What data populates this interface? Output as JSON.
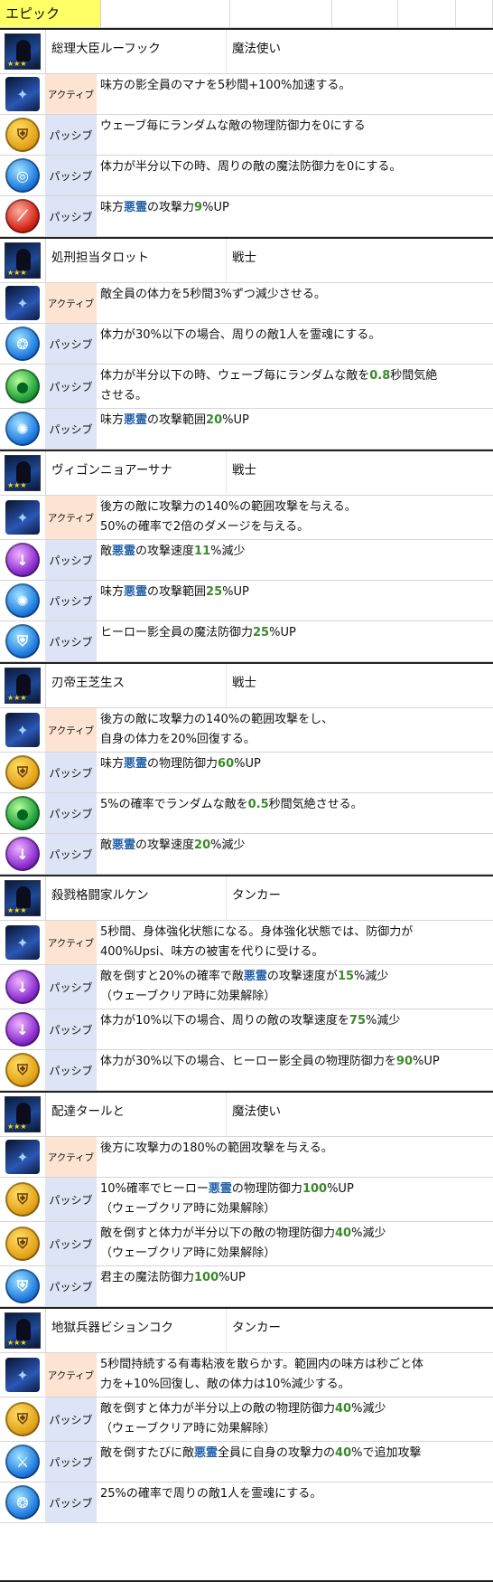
{
  "header": {
    "title": "エピック"
  },
  "labels": {
    "active": "アクティブ",
    "passive": "パッシブ"
  },
  "colors": {
    "header_bg": "#ffff66",
    "active_bg": "#fde3d2",
    "passive_bg": "#dce4f5",
    "highlight": "#3a8a2a",
    "keyword": "#1f5fa8"
  },
  "heroes": [
    {
      "name": "総理大臣ルーフック",
      "role": "魔法使い",
      "skills": [
        {
          "type": "active",
          "icon": "dark-hero-skill-icon",
          "lines": [
            [
              {
                "t": "味方の影全員のマナを5秒間+100%加速する。"
              }
            ]
          ]
        },
        {
          "type": "passive",
          "icon": "gold-shield-icon",
          "lines": [
            [
              {
                "t": "ウェーブ毎にランダムな敵の物理防御力を0にする"
              }
            ]
          ]
        },
        {
          "type": "passive",
          "icon": "blue-swirl-icon",
          "lines": [
            [
              {
                "t": "体力が半分以下の時、周りの敵の魔法防御力を0にする。"
              }
            ]
          ]
        },
        {
          "type": "passive",
          "icon": "red-claw-icon",
          "lines": [
            [
              {
                "t": "味方"
              },
              {
                "t": "悪霊",
                "s": "bl"
              },
              {
                "t": "の攻撃力"
              },
              {
                "t": "9",
                "s": "hl"
              },
              {
                "t": "%UP"
              }
            ]
          ]
        }
      ]
    },
    {
      "name": "処刑担当タロット",
      "role": "戦士",
      "skills": [
        {
          "type": "active",
          "icon": "dark-hero-skill-icon",
          "lines": [
            [
              {
                "t": "敵全員の体力を5秒間3%ずつ減少させる。"
              }
            ]
          ]
        },
        {
          "type": "passive",
          "icon": "blue-spirit-icon",
          "lines": [
            [
              {
                "t": "体力が30%以下の場合、周りの敵1人を霊魂にする。"
              }
            ]
          ]
        },
        {
          "type": "passive",
          "icon": "green-person-icon",
          "lines": [
            [
              {
                "t": "体力が半分以下の時、ウェーブ毎にランダムな敵を"
              },
              {
                "t": "0.8",
                "s": "hl"
              },
              {
                "t": "秒間気絶"
              }
            ],
            [
              {
                "t": "させる。"
              }
            ]
          ]
        },
        {
          "type": "passive",
          "icon": "blue-burst-icon",
          "lines": [
            [
              {
                "t": "味方"
              },
              {
                "t": "悪霊",
                "s": "bl"
              },
              {
                "t": "の攻撃範囲"
              },
              {
                "t": "20",
                "s": "hl"
              },
              {
                "t": "%UP"
              }
            ]
          ]
        }
      ]
    },
    {
      "name": "ヴィゴンニョアーサナ",
      "role": "戦士",
      "skills": [
        {
          "type": "active",
          "icon": "dark-hero-skill-icon",
          "lines": [
            [
              {
                "t": "後方の敵に攻撃力の140%の範囲攻撃を与える。"
              }
            ],
            [
              {
                "t": "50%の確率で2倍のダメージを与える。"
              }
            ]
          ]
        },
        {
          "type": "passive",
          "icon": "purple-down-arrow-icon",
          "lines": [
            [
              {
                "t": "敵"
              },
              {
                "t": "悪霊",
                "s": "bl"
              },
              {
                "t": "の攻撃速度"
              },
              {
                "t": "11",
                "s": "hl"
              },
              {
                "t": "%減少"
              }
            ]
          ]
        },
        {
          "type": "passive",
          "icon": "blue-burst-icon",
          "lines": [
            [
              {
                "t": "味方"
              },
              {
                "t": "悪霊",
                "s": "bl"
              },
              {
                "t": "の攻撃範囲"
              },
              {
                "t": "25",
                "s": "hl"
              },
              {
                "t": "%UP"
              }
            ]
          ]
        },
        {
          "type": "passive",
          "icon": "blue-shield-icon",
          "lines": [
            [
              {
                "t": "ヒーロー影全員の魔法防御力"
              },
              {
                "t": "25",
                "s": "hl"
              },
              {
                "t": "%UP"
              }
            ]
          ]
        }
      ]
    },
    {
      "name": "刃帝王芝生ス",
      "role": "戦士",
      "skills": [
        {
          "type": "active",
          "icon": "dark-hero-skill-icon",
          "lines": [
            [
              {
                "t": "後方の敵に攻撃力の140%の範囲攻撃をし、"
              }
            ],
            [
              {
                "t": "自身の体力を20%回復する。"
              }
            ]
          ]
        },
        {
          "type": "passive",
          "icon": "gold-shield-icon",
          "lines": [
            [
              {
                "t": "味方"
              },
              {
                "t": "悪霊",
                "s": "bl"
              },
              {
                "t": "の物理防御力"
              },
              {
                "t": "60",
                "s": "hl"
              },
              {
                "t": "%UP"
              }
            ]
          ]
        },
        {
          "type": "passive",
          "icon": "green-person-icon",
          "lines": [
            [
              {
                "t": "5%の確率でランダムな敵を"
              },
              {
                "t": "0.5",
                "s": "hl"
              },
              {
                "t": "秒間気絶させる。"
              }
            ]
          ]
        },
        {
          "type": "passive",
          "icon": "purple-down-arrow-icon",
          "lines": [
            [
              {
                "t": "敵"
              },
              {
                "t": "悪霊",
                "s": "bl"
              },
              {
                "t": "の攻撃速度"
              },
              {
                "t": "20",
                "s": "hl"
              },
              {
                "t": "%減少"
              }
            ]
          ]
        }
      ]
    },
    {
      "name": "殺戮格闘家ルケン",
      "role": "タンカー",
      "skills": [
        {
          "type": "active",
          "icon": "dark-hero-skill-icon",
          "lines": [
            [
              {
                "t": "5秒間、身体強化状態になる。身体強化状態では、防御力が"
              }
            ],
            [
              {
                "t": "400%Upsi、味方の被害を代りに受ける。"
              }
            ]
          ]
        },
        {
          "type": "passive",
          "icon": "purple-down-arrow-icon",
          "lines": [
            [
              {
                "t": "敵を倒すと20%の確率で敵"
              },
              {
                "t": "悪霊",
                "s": "bl"
              },
              {
                "t": "の攻撃速度が"
              },
              {
                "t": "15",
                "s": "hl"
              },
              {
                "t": "%減少"
              }
            ],
            [
              {
                "t": "（ウェーブクリア時に効果解除）"
              }
            ]
          ]
        },
        {
          "type": "passive",
          "icon": "purple-down-arrow-icon",
          "lines": [
            [
              {
                "t": "体力が10%以下の場合、周りの敵の攻撃速度を"
              },
              {
                "t": "75",
                "s": "hl"
              },
              {
                "t": "%減少"
              }
            ]
          ]
        },
        {
          "type": "passive",
          "icon": "gold-shield-icon",
          "lines": [
            [
              {
                "t": "体力が30%以下の場合、ヒーロー影全員の物理防御力を"
              },
              {
                "t": "90",
                "s": "hl"
              },
              {
                "t": "%UP"
              }
            ]
          ]
        }
      ]
    },
    {
      "name": "配達タールと",
      "role": "魔法使い",
      "skills": [
        {
          "type": "active",
          "icon": "dark-hero-skill-icon",
          "lines": [
            [
              {
                "t": "後方に攻撃力の180%の範囲攻撃を与える。"
              }
            ]
          ]
        },
        {
          "type": "passive",
          "icon": "gold-shield-icon",
          "lines": [
            [
              {
                "t": "10%確率でヒーロー"
              },
              {
                "t": "悪霊",
                "s": "bl"
              },
              {
                "t": "の物理防御力"
              },
              {
                "t": "100",
                "s": "hl"
              },
              {
                "t": "%UP"
              }
            ],
            [
              {
                "t": "（ウェーブクリア時に効果解除）"
              }
            ]
          ]
        },
        {
          "type": "passive",
          "icon": "gold-broken-shield-icon",
          "lines": [
            [
              {
                "t": "敵を倒すと体力が半分以下の敵の物理防御力"
              },
              {
                "t": "40",
                "s": "hl"
              },
              {
                "t": "%減少"
              }
            ],
            [
              {
                "t": "（ウェーブクリア時に効果解除）"
              }
            ]
          ]
        },
        {
          "type": "passive",
          "icon": "blue-shield-icon",
          "lines": [
            [
              {
                "t": "君主の魔法防御力"
              },
              {
                "t": "100",
                "s": "hl"
              },
              {
                "t": "%UP"
              }
            ]
          ]
        }
      ]
    },
    {
      "name": "地獄兵器ビションコク",
      "role": "タンカー",
      "skills": [
        {
          "type": "active",
          "icon": "dark-hero-skill-icon",
          "lines": [
            [
              {
                "t": "5秒間持続する有毒粘液を散らかす。範囲内の味方は秒ごと体"
              }
            ],
            [
              {
                "t": "力を+10%回復し、敵の体力は10%減少する。"
              }
            ]
          ]
        },
        {
          "type": "passive",
          "icon": "gold-broken-shield-icon",
          "lines": [
            [
              {
                "t": "敵を倒すと体力が半分以上の敵の物理防御力"
              },
              {
                "t": "40",
                "s": "hl"
              },
              {
                "t": "%減少"
              }
            ],
            [
              {
                "t": "（ウェーブクリア時に効果解除）"
              }
            ]
          ]
        },
        {
          "type": "passive",
          "icon": "blue-sword-icon",
          "lines": [
            [
              {
                "t": "敵を倒すたびに敵"
              },
              {
                "t": "悪霊",
                "s": "bl"
              },
              {
                "t": "全員に自身の攻撃力の"
              },
              {
                "t": "40",
                "s": "hl"
              },
              {
                "t": "%で追加攻撃"
              }
            ]
          ]
        },
        {
          "type": "passive",
          "icon": "blue-spirit-icon",
          "lines": [
            [
              {
                "t": "25%の確率で周りの敵1人を霊魂にする。"
              }
            ]
          ]
        }
      ]
    }
  ]
}
